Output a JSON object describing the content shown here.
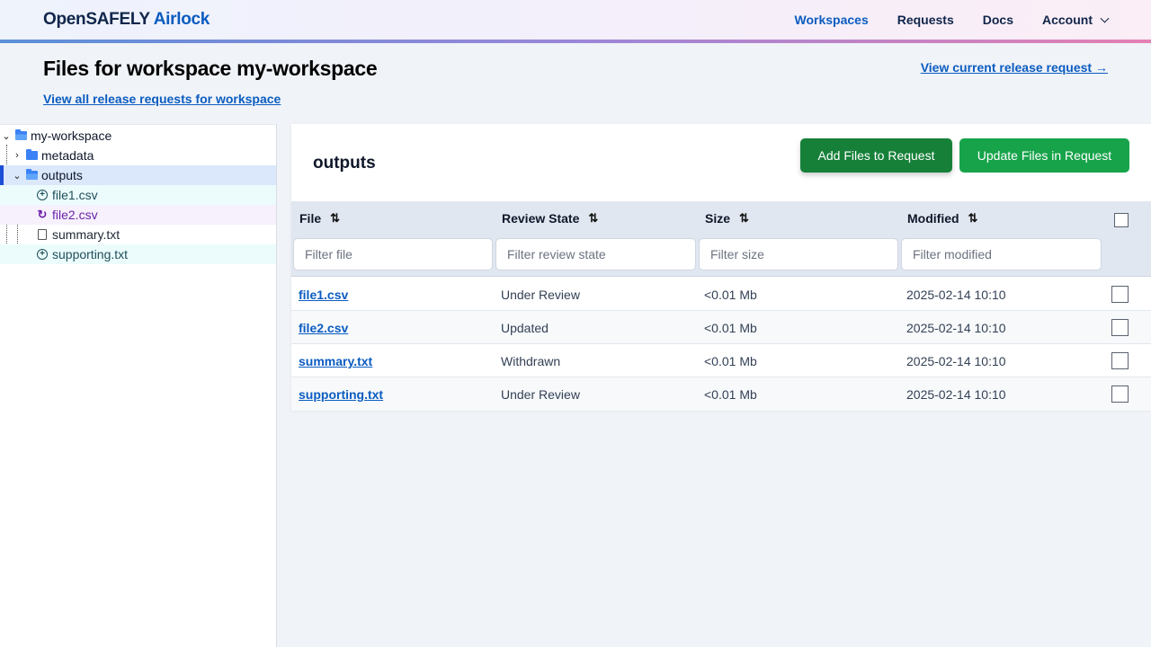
{
  "header": {
    "brand_primary": "OpenSAFELY",
    "brand_secondary": "Airlock",
    "nav": [
      {
        "label": "Workspaces",
        "active": true
      },
      {
        "label": "Requests",
        "active": false
      },
      {
        "label": "Docs",
        "active": false
      },
      {
        "label": "Account",
        "active": false,
        "dropdown": true
      }
    ]
  },
  "page": {
    "title": "Files for workspace my-workspace",
    "all_requests_link": "View all release requests for workspace",
    "current_request_link": "View current release request →"
  },
  "tree": {
    "root": {
      "label": "my-workspace",
      "icon": "folder-open-icon",
      "expanded": true
    },
    "items": [
      {
        "label": "metadata",
        "icon": "folder-icon",
        "expanded": false,
        "state": ""
      },
      {
        "label": "outputs",
        "icon": "folder-open-icon",
        "expanded": true,
        "selected": true,
        "state": ""
      },
      {
        "label": "file1.csv",
        "icon": "plus-circle-icon",
        "state": "under-review"
      },
      {
        "label": "file2.csv",
        "icon": "refresh-icon",
        "state": "updated"
      },
      {
        "label": "summary.txt",
        "icon": "file-icon",
        "state": "withdrawn"
      },
      {
        "label": "supporting.txt",
        "icon": "plus-circle-icon",
        "state": "under-review"
      }
    ]
  },
  "panel": {
    "title": "outputs",
    "add_button": "Add Files to Request",
    "update_button": "Update Files in Request"
  },
  "table": {
    "columns": [
      {
        "label": "File",
        "filter_placeholder": "Filter file"
      },
      {
        "label": "Review State",
        "filter_placeholder": "Filter review state"
      },
      {
        "label": "Size",
        "filter_placeholder": "Filter size"
      },
      {
        "label": "Modified",
        "filter_placeholder": "Filter modified"
      }
    ],
    "rows": [
      {
        "file": "file1.csv",
        "state": "Under Review",
        "size": "<0.01 Mb",
        "modified": "2025-02-14 10:10",
        "checked": false
      },
      {
        "file": "file2.csv",
        "state": "Updated",
        "size": "<0.01 Mb",
        "modified": "2025-02-14 10:10",
        "checked": false
      },
      {
        "file": "summary.txt",
        "state": "Withdrawn",
        "size": "<0.01 Mb",
        "modified": "2025-02-14 10:10",
        "checked": false
      },
      {
        "file": "supporting.txt",
        "state": "Under Review",
        "size": "<0.01 Mb",
        "modified": "2025-02-14 10:10",
        "checked": false
      }
    ]
  },
  "colors": {
    "brand_dark": "#10254a",
    "link_blue": "#0b5cc0",
    "add_green": "#168039",
    "update_green": "#17a34a",
    "under_review_bg": "#ecfcfd",
    "updated_bg": "#f6f1fd",
    "selected_bg": "#dbe7fb"
  }
}
